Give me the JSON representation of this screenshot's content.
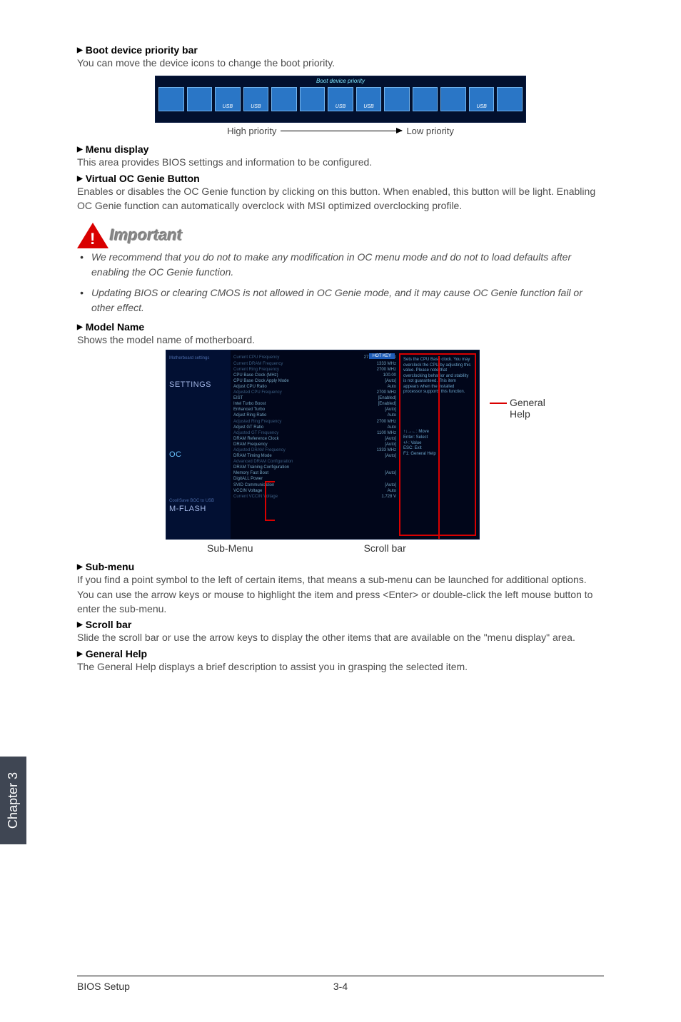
{
  "headings": {
    "boot": "Boot device priority bar",
    "menu": "Menu display",
    "virtual": "Virtual OC Genie Button",
    "model": "Model Name",
    "submenu": "Sub-menu",
    "scroll": "Scroll bar",
    "general": "General Help"
  },
  "paras": {
    "boot": "You can move the device icons to change the boot priority.",
    "menu": "This area provides BIOS settings and information to be configured.",
    "virtual": "Enables or disables the OC Genie function by clicking on this button. When enabled, this button will be light. Enabling OC Genie function can automatically overclock with MSI optimized overclocking profile.",
    "model": "Shows the model name of motherboard.",
    "submenu": "If you find a point symbol to the left of certain items, that means a sub-menu can be launched for additional options. You can use the arrow keys or mouse to highlight the item and press <Enter> or double-click the left mouse button to enter the sub-menu.",
    "scroll": "Slide the scroll bar or use the arrow keys to display the other items that are available on the \"menu display\" area.",
    "general": "The General Help displays a brief description to assist you in grasping the selected item."
  },
  "bootbar": {
    "title": "Boot device priority",
    "high": "High priority",
    "low": "Low priority",
    "icons": [
      "",
      "",
      "USB",
      "USB",
      "",
      "",
      "USB",
      "USB",
      "",
      "",
      "",
      "USB",
      ""
    ]
  },
  "important": {
    "word": "Important",
    "note1": "We recommend that you do not to make any modification in OC menu mode and do not to load defaults after enabling the OC Genie function.",
    "note2": "Updating BIOS or clearing CMOS is not allowed in OC Genie mode, and it may cause OC Genie function fail or other effect."
  },
  "bios": {
    "hotkey": "HOT KEY",
    "left": {
      "motherboard": "Motherboard settings",
      "settings": "SETTINGS",
      "oc": "OC",
      "coolsave": "Cool/Save BOC to USB",
      "mflash": "M-FLASH"
    },
    "settings": [
      {
        "k": "Current CPU Frequency",
        "v": "27 x 100.00 MHz",
        "dim": true
      },
      {
        "k": "Current DRAM Frequency",
        "v": "1333 MHz",
        "dim": true
      },
      {
        "k": "Current Ring Frequency",
        "v": "2700 MHz",
        "dim": true
      },
      {
        "k": "CPU Base Clock (MHz)",
        "v": "100.00",
        "dim": false
      },
      {
        "k": "CPU Base Clock Apply Mode",
        "v": "[Auto]",
        "dim": false
      },
      {
        "k": "Adjust CPU Ratio",
        "v": "Auto",
        "dim": false
      },
      {
        "k": "Adjusted CPU Frequency",
        "v": "2700 MHz",
        "dim": true
      },
      {
        "k": "EIST",
        "v": "[Enabled]",
        "dim": false
      },
      {
        "k": "Intel Turbo Boost",
        "v": "[Enabled]",
        "dim": false
      },
      {
        "k": "Enhanced Turbo",
        "v": "[Auto]",
        "dim": false
      },
      {
        "k": "Adjust Ring Ratio",
        "v": "Auto",
        "dim": false
      },
      {
        "k": "Adjusted Ring Frequency",
        "v": "2700 MHz",
        "dim": true
      },
      {
        "k": "Adjust GT Ratio",
        "v": "Auto",
        "dim": false
      },
      {
        "k": "Adjusted GT Frequency",
        "v": "1100 MHz",
        "dim": true
      },
      {
        "k": "DRAM Reference Clock",
        "v": "[Auto]",
        "dim": false
      },
      {
        "k": "DRAM Frequency",
        "v": "[Auto]",
        "dim": false
      },
      {
        "k": "Adjusted DRAM Frequency",
        "v": "1333 MHz",
        "dim": true
      },
      {
        "k": "DRAM Timing Mode",
        "v": "[Auto]",
        "dim": false
      },
      {
        "k": "Advanced DRAM Configuration",
        "v": "",
        "dim": true
      },
      {
        "k": "DRAM Training Configuration",
        "v": "",
        "dim": false
      },
      {
        "k": "Memory Fast Boot",
        "v": "[Auto]",
        "dim": false
      },
      {
        "k": "DigitALL Power",
        "v": "",
        "dim": false
      },
      {
        "k": "SVID Communication",
        "v": "[Auto]",
        "dim": false
      },
      {
        "k": "VCCIN Voltage",
        "v": "Auto",
        "dim": false
      },
      {
        "k": "Current VCCIN Voltage",
        "v": "1.728 V",
        "dim": true
      }
    ],
    "help_text": "Sets the CPU Base clock. You may overclock the CPU by adjusting this value. Please note that overclocking behavior and stability is not guaranteed. This item appears when the installed processor supports this function.",
    "nav": "↑↓→←: Move\nEnter: Select\n+/-: Value\nESC: Exit\nF1: General Help"
  },
  "labels": {
    "general_help": "General Help",
    "sub_menu": "Sub-Menu",
    "scroll_bar": "Scroll bar"
  },
  "chapter": "Chapter 3",
  "footer": {
    "title": "BIOS Setup",
    "page": "3-4"
  }
}
